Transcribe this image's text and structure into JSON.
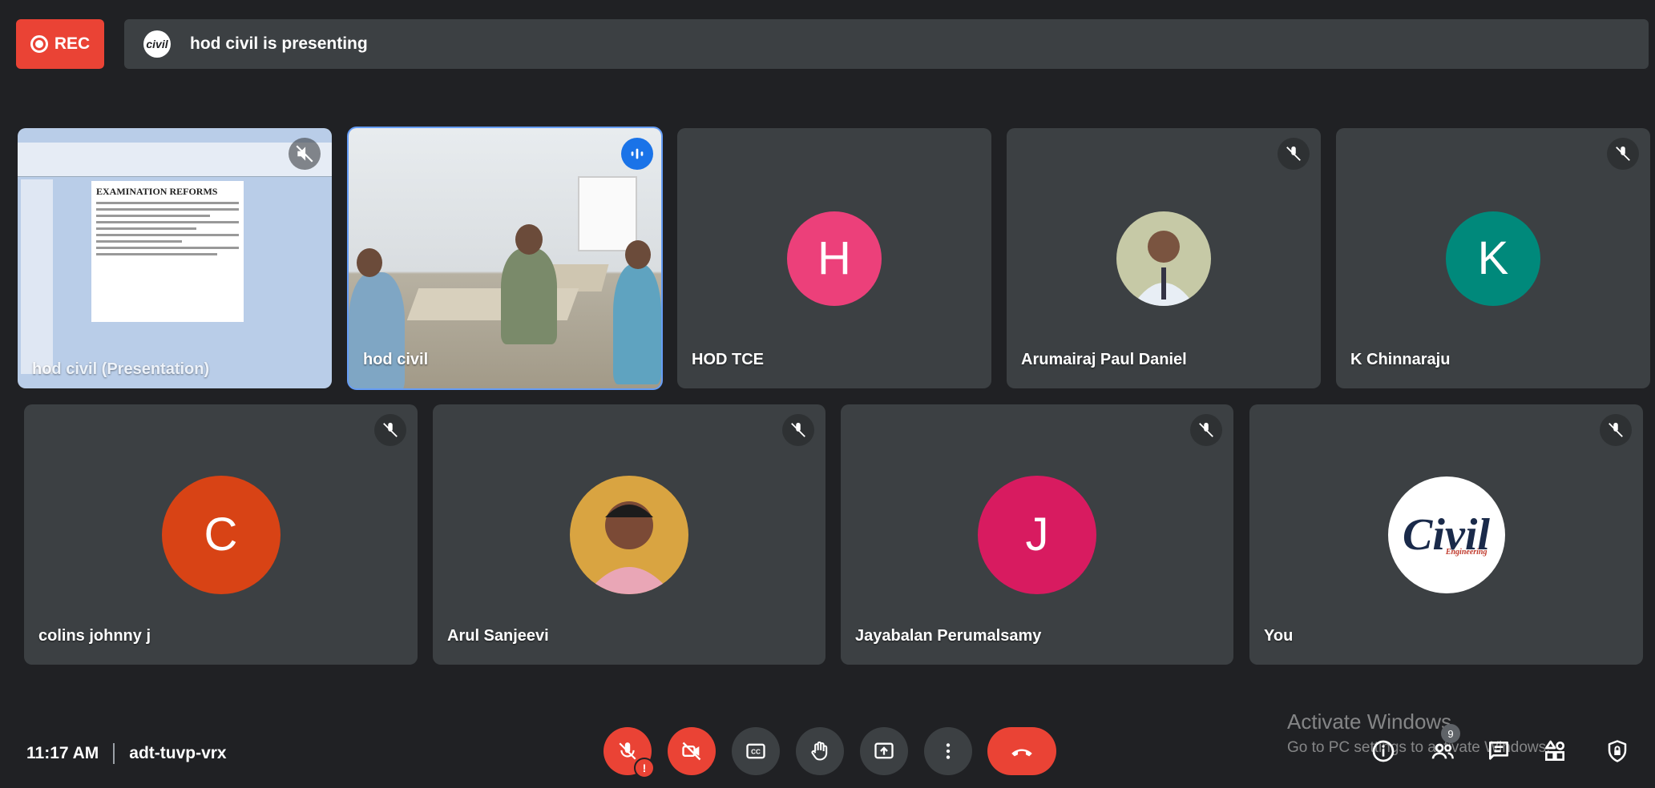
{
  "recording": {
    "label": "REC"
  },
  "presenter": {
    "avatar_text": "civil",
    "text": "hod civil is presenting"
  },
  "presentation_tile": {
    "name": "hod civil (Presentation)",
    "slide_title": "EXAMINATION REFORMS"
  },
  "tiles": [
    {
      "name": "hod civil",
      "kind": "camera",
      "speaking": true
    },
    {
      "name": "HOD TCE",
      "kind": "initial",
      "initial": "H",
      "color": "#ec407a"
    },
    {
      "name": "Arumairaj Paul Daniel",
      "kind": "photo"
    },
    {
      "name": "K Chinnaraju",
      "kind": "initial",
      "initial": "K",
      "color": "#00897b"
    },
    {
      "name": "colins johnny j",
      "kind": "initial",
      "initial": "C",
      "color": "#d84315"
    },
    {
      "name": "Arul Sanjeevi",
      "kind": "photo"
    },
    {
      "name": "Jayabalan Perumalsamy",
      "kind": "initial",
      "initial": "J",
      "color": "#d81b60"
    },
    {
      "name": "You",
      "kind": "logo",
      "logo_text": "Civil",
      "logo_sub": "Engineering"
    }
  ],
  "meeting": {
    "time": "11:17 AM",
    "code": "adt-tuvp-vrx"
  },
  "controls": {
    "mic_alert": "!",
    "participants_count": "9"
  },
  "watermark": {
    "title": "Activate Windows",
    "sub": "Go to PC settings to activate Windows."
  },
  "icons": {
    "mic_off": "mic-off-icon",
    "cam_off": "videocam-off-icon",
    "captions": "closed-caption-icon",
    "hand": "raise-hand-icon",
    "present": "present-screen-icon",
    "more": "more-vert-icon",
    "hangup": "call-end-icon",
    "info": "info-icon",
    "people": "people-icon",
    "chat": "chat-icon",
    "activities": "activities-icon",
    "host": "host-controls-icon"
  },
  "colors": {
    "accent": "#1a73e8",
    "danger": "#ea4335",
    "tile": "#3c4043",
    "background": "#202124"
  }
}
